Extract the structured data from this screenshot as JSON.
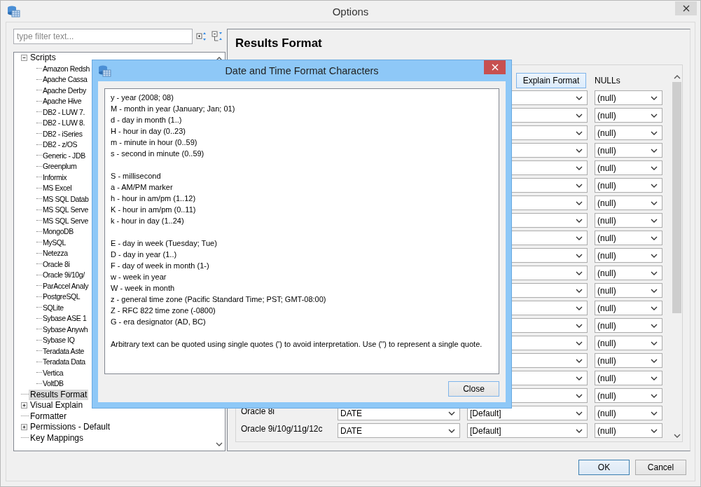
{
  "window": {
    "title": "Options"
  },
  "filter": {
    "placeholder": "type filter text..."
  },
  "tree": [
    {
      "label": "Scripts",
      "expanded": true,
      "selected": false,
      "children": [
        {
          "label": "Amazon Redsh"
        },
        {
          "label": "Apache Cassa"
        },
        {
          "label": "Apache Derby"
        },
        {
          "label": "Apache Hive"
        },
        {
          "label": "DB2 - LUW 7."
        },
        {
          "label": "DB2 - LUW 8."
        },
        {
          "label": "DB2 - iSeries"
        },
        {
          "label": "DB2 - z/OS"
        },
        {
          "label": "Generic - JDB"
        },
        {
          "label": "Greenplum"
        },
        {
          "label": "Informix"
        },
        {
          "label": "MS Excel"
        },
        {
          "label": "MS SQL Datab"
        },
        {
          "label": "MS SQL Serve"
        },
        {
          "label": "MS SQL Serve"
        },
        {
          "label": "MongoDB"
        },
        {
          "label": "MySQL"
        },
        {
          "label": "Netezza"
        },
        {
          "label": "Oracle 8i"
        },
        {
          "label": "Oracle 9i/10g/"
        },
        {
          "label": "ParAccel Analy"
        },
        {
          "label": "PostgreSQL"
        },
        {
          "label": "SQLite"
        },
        {
          "label": "Sybase ASE 1"
        },
        {
          "label": "Sybase Anywh"
        },
        {
          "label": "Sybase IQ"
        },
        {
          "label": "Teradata Aste"
        },
        {
          "label": "Teradata Data"
        },
        {
          "label": "Vertica"
        },
        {
          "label": "VoltDB"
        }
      ]
    },
    {
      "label": "Results Format",
      "selected": true
    },
    {
      "label": "Visual Explain",
      "expanded": false,
      "selected": false
    },
    {
      "label": "Formatter",
      "selected": false
    },
    {
      "label": "Permissions - Default",
      "expanded": false,
      "selected": false
    },
    {
      "label": "Key Mappings",
      "selected": false
    }
  ],
  "panel": {
    "title": "Results Format",
    "explain_button": "Explain Format",
    "nulls_header": "NULLs",
    "rows": [
      {
        "nulls": "(null)"
      },
      {
        "nulls": "(null)"
      },
      {
        "nulls": "(null)"
      },
      {
        "nulls": "(null)"
      },
      {
        "nulls": "(null)"
      },
      {
        "nulls": "(null)"
      },
      {
        "nulls": "(null)"
      },
      {
        "nulls": "(null)"
      },
      {
        "nulls": "(null)"
      },
      {
        "nulls": "(null)"
      },
      {
        "nulls": "(null)"
      },
      {
        "nulls": "(null)"
      },
      {
        "nulls": "(null)"
      },
      {
        "nulls": "(null)"
      },
      {
        "nulls": "(null)"
      },
      {
        "nulls": "(null)"
      },
      {
        "nulls": "(null)"
      },
      {
        "nulls": "(null)"
      },
      {
        "name": "Oracle 8i",
        "type": "DATE",
        "format": "[Default]",
        "nulls": "(null)"
      },
      {
        "name": "Oracle 9i/10g/11g/12c",
        "type": "DATE",
        "format": "[Default]",
        "nulls": "(null)"
      }
    ]
  },
  "buttons": [
    {
      "label": "OK",
      "focused": true
    },
    {
      "label": "Cancel",
      "focused": false
    }
  ],
  "dialog": {
    "title": "Date and Time Format Characters",
    "groups": [
      [
        "y - year (2008; 08)",
        "M - month in year (January; Jan; 01)",
        "d - day in month (1..)",
        "H - hour in day (0..23)",
        "m - minute in hour (0..59)",
        "s - second in minute (0..59)"
      ],
      [
        "S - millisecond",
        "a - AM/PM marker",
        "h - hour in am/pm (1..12)",
        "K - hour in am/pm (0..11)",
        "k - hour in day (1..24)"
      ],
      [
        "E - day in week (Tuesday; Tue)",
        "D - day in year (1..)",
        "F - day of week in month (1-)",
        "w - week in year",
        "W - week in month",
        "z - general time zone (Pacific Standard Time; PST; GMT-08:00)",
        "Z - RFC 822 time zone (-0800)",
        "G - era designator (AD, BC)"
      ],
      [
        "Arbitrary text can be quoted using single quotes (') to avoid interpretation.  Use ('') to represent a single quote."
      ]
    ],
    "close_button": "Close"
  }
}
